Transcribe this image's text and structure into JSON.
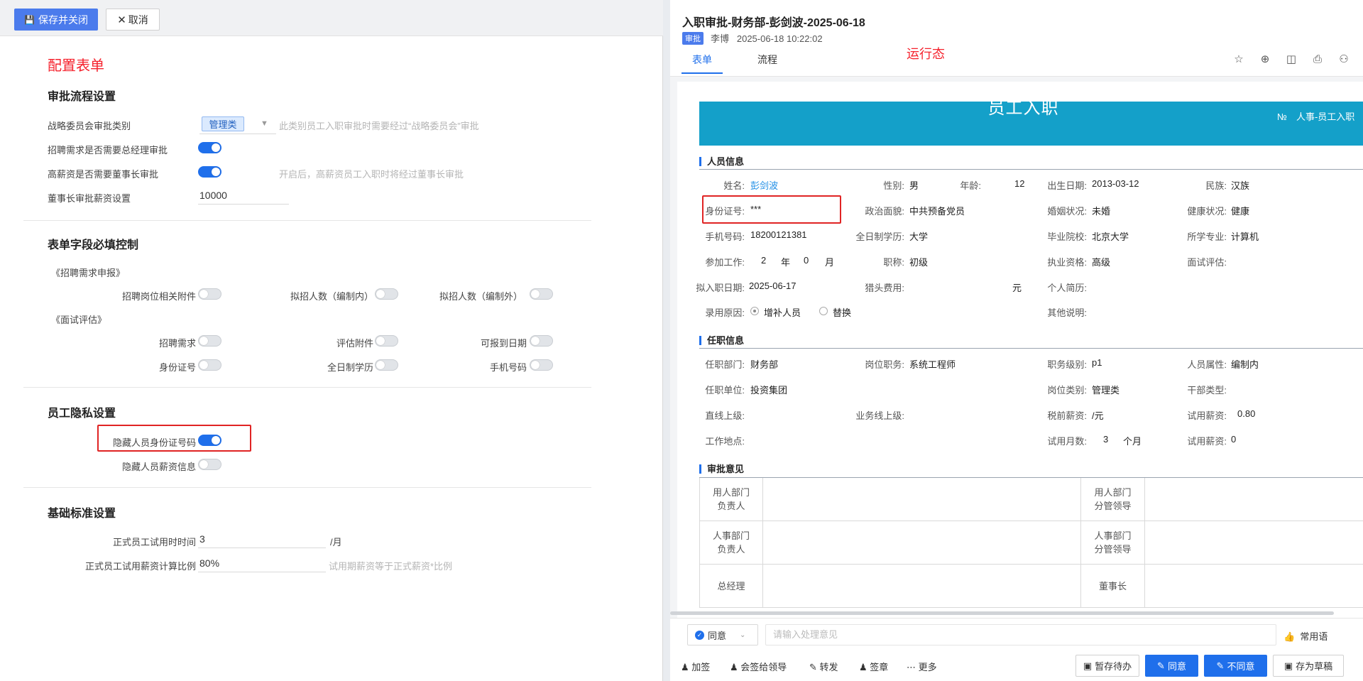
{
  "left": {
    "toolbar": {
      "save_label": "保存并关闭",
      "cancel_label": "取消"
    },
    "config_label": "配置表单",
    "sections": {
      "approval_flow": {
        "title": "审批流程设置",
        "strategy_label": "战略委员会审批类别",
        "strategy_tag": "管理类",
        "strategy_hint": "此类别员工入职审批时需要经过“战略委员会”审批",
        "gm_label": "招聘需求是否需要总经理审批",
        "gm_on": true,
        "chairman_label": "高薪资是否需要董事长审批",
        "chairman_on": true,
        "chairman_hint": "开启后，高薪资员工入职时将经过董事长审批",
        "salary_label": "董事长审批薪资设置",
        "salary_value": "10000"
      },
      "required_fields": {
        "title": "表单字段必填控制",
        "group1": "《招聘需求申报》",
        "g1_items": [
          "招聘岗位相关附件",
          "拟招人数（编制内）",
          "拟招人数（编制外）"
        ],
        "group2": "《面试评估》",
        "g2_items": [
          "招聘需求",
          "评估附件",
          "可报到日期",
          "身份证号",
          "全日制学历",
          "手机号码"
        ]
      },
      "privacy": {
        "title": "员工隐私设置",
        "hide_id_label": "隐藏人员身份证号码",
        "hide_id_on": true,
        "hide_salary_label": "隐藏人员薪资信息",
        "hide_salary_on": false
      },
      "basic": {
        "title": "基础标准设置",
        "probation_label": "正式员工试用时时间",
        "probation_value": "3",
        "probation_unit": "/月",
        "ratio_label": "正式员工试用薪资计算比例",
        "ratio_value": "80%",
        "ratio_hint": "试用期薪资等于正式薪资*比例"
      }
    }
  },
  "right": {
    "title": "入职审批-财务部-彭剑波-2025-06-18",
    "badge": "审批",
    "submitter": "李博",
    "submit_time": "2025-06-18 10:22:02",
    "tabs": [
      "表单",
      "流程"
    ],
    "runtime_label": "运行态",
    "form": {
      "banner_title": "员工入职",
      "banner_no": "№　人事-员工入职",
      "groups": [
        "人员信息",
        "任职信息",
        "审批意见"
      ],
      "personal": {
        "name_l": "姓名:",
        "name_v": "彭剑波",
        "gender_l": "性别:",
        "gender_v": "男",
        "age_l": "年龄:",
        "age_v": "12",
        "birth_l": "出生日期:",
        "birth_v": "2013-03-12",
        "ethnic_l": "民族:",
        "ethnic_v": "汉族",
        "id_l": "身份证号:",
        "id_v": "***",
        "political_l": "政治面貌:",
        "political_v": "中共预备党员",
        "marital_l": "婚姻状况:",
        "marital_v": "未婚",
        "health_l": "健康状况:",
        "health_v": "健康",
        "phone_l": "手机号码:",
        "phone_v": "18200121381",
        "edu_l": "全日制学历:",
        "edu_v": "大学",
        "school_l": "毕业院校:",
        "school_v": "北京大学",
        "major_l": "所学专业:",
        "major_v": "计算机",
        "work_l": "参加工作:",
        "work_years": "2",
        "work_y_unit": "年",
        "work_months": "0",
        "work_m_unit": "月",
        "title_l": "职称:",
        "title_v": "初级",
        "qual_l": "执业资格:",
        "qual_v": "高级",
        "interview_l": "面试评估:",
        "join_l": "拟入职日期:",
        "join_v": "2025-06-17",
        "headhunt_l": "猎头费用:",
        "headhunt_unit": "元",
        "resume_l": "个人简历:",
        "reason_l": "录用原因:",
        "reason_opt1": "增补人员",
        "reason_opt2": "替换",
        "other_l": "其他说明:"
      },
      "job": {
        "dept_l": "任职部门:",
        "dept_v": "财务部",
        "post_l": "岗位职务:",
        "post_v": "系统工程师",
        "level_l": "职务级别:",
        "level_v": "p1",
        "attr_l": "人员属性:",
        "attr_v": "编制内",
        "unit_l": "任职单位:",
        "unit_v": "投资集团",
        "posttype_l": "岗位类别:",
        "posttype_v": "管理类",
        "cadre_l": "干部类型:",
        "leader_l": "直线上级:",
        "bizleader_l": "业务线上级:",
        "pretax_l": "税前薪资:",
        "pretax_v": "/元",
        "probsal_l": "试用薪资:",
        "probsal_v": "0.80",
        "place_l": "工作地点:",
        "probmonth_l": "试用月数:",
        "probmonth_v": "3",
        "probmonth_unit": "个月",
        "probsal2_l": "试用薪资:",
        "probsal2_v": "0"
      },
      "approval": {
        "c1": "用人部门\n负责人",
        "c2": "用人部门\n分管领导",
        "c3": "人事部门\n负责人",
        "c4": "人事部门\n分管领导",
        "c5": "总经理",
        "c6": "董事长"
      }
    },
    "footer": {
      "opinion": "同意",
      "opinion_placeholder": "请输入处理意见",
      "phrase": "常用语",
      "actions": [
        "加签",
        "会签给领导",
        "转发",
        "签章",
        "更多"
      ],
      "buttons": [
        "暂存待办",
        "同意",
        "不同意",
        "存为草稿"
      ]
    }
  }
}
